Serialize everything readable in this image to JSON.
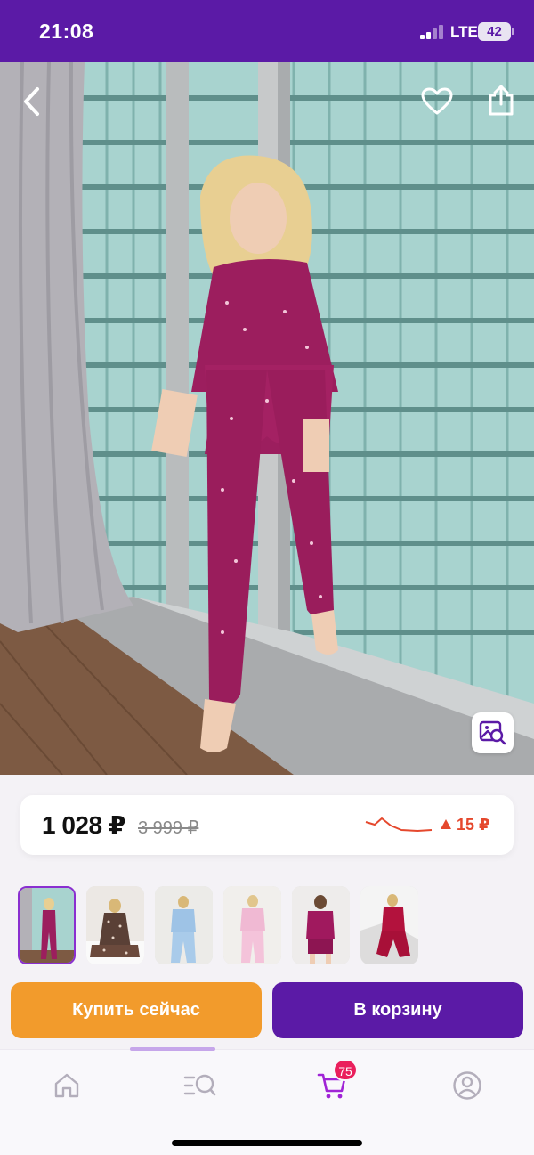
{
  "status_bar": {
    "time": "21:08",
    "network": "LTE",
    "battery": "42"
  },
  "product": {
    "price_current": "1 028 ₽",
    "price_old": "3 999 ₽",
    "price_change": "15 ₽",
    "price_change_color": "#e5482d"
  },
  "actions": {
    "buy_now_label": "Купить сейчас",
    "add_to_cart_label": "В корзину"
  },
  "nav": {
    "cart_count": "75",
    "items": [
      "home-icon",
      "catalog-search-icon",
      "cart-icon",
      "profile-icon"
    ]
  },
  "colors": {
    "brand": "#5b1aa6",
    "buy_button": "#f29b2c",
    "badge": "#ea1f5c"
  },
  "icons": [
    "back-arrow-icon",
    "heart-icon",
    "share-icon",
    "image-search-icon"
  ]
}
